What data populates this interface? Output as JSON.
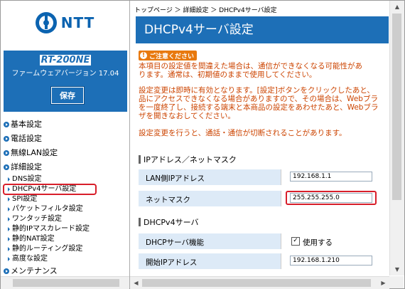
{
  "brand": {
    "logo_text": "NTT"
  },
  "device": {
    "model": "RT-200NE",
    "firmware_label": "ファームウェアバージョン 17.04",
    "save_label": "保存"
  },
  "nav": {
    "sections": [
      "基本設定",
      "電話設定",
      "無線LAN設定",
      "詳細設定"
    ],
    "detail_items": [
      "DNS設定",
      "DHCPv4サーバ設定",
      "SPI設定",
      "パケットフィルタ設定",
      "ワンタッチ設定",
      "静的IPマスカレード設定",
      "静的NAT設定",
      "静的ルーティング設定",
      "高度な設定"
    ],
    "maintenance": "メンテナンス"
  },
  "breadcrumb": "トップページ ＞ 詳細設定 ＞ DHCPv4サーバ設定",
  "page_title": "DHCPv4サーバ設定",
  "caution_label": "ご注意ください",
  "warnings": [
    "本項目の設定値を間違えた場合は、通信ができなくなる可能性があ",
    "ります。通常は、初期値のままで使用してください。",
    "設定変更は即時に有効となります。[設定]ボタンをクリックしたあと、",
    "品にアクセスできなくなる場合がありますので、その場合は、Webブラ",
    "を一度終了し、接続する端末と本商品の設定をあわせたあと、Webブラ",
    "ザを開きなおしてください。",
    "設定変更を行うと、通話・通信が切断されることがあります。"
  ],
  "ip_section": {
    "title": "IPアドレス／ネットマスク",
    "lan_label": "LAN側IPアドレス",
    "lan_value": "192.168.1.1",
    "mask_label": "ネットマスク",
    "mask_value": "255.255.255.0"
  },
  "dhcp_section": {
    "title": "DHCPv4サーバ",
    "func_label": "DHCPサーバ機能",
    "func_value": "使用する",
    "start_label": "開始IPアドレス",
    "start_value": "192.168.1.210"
  }
}
